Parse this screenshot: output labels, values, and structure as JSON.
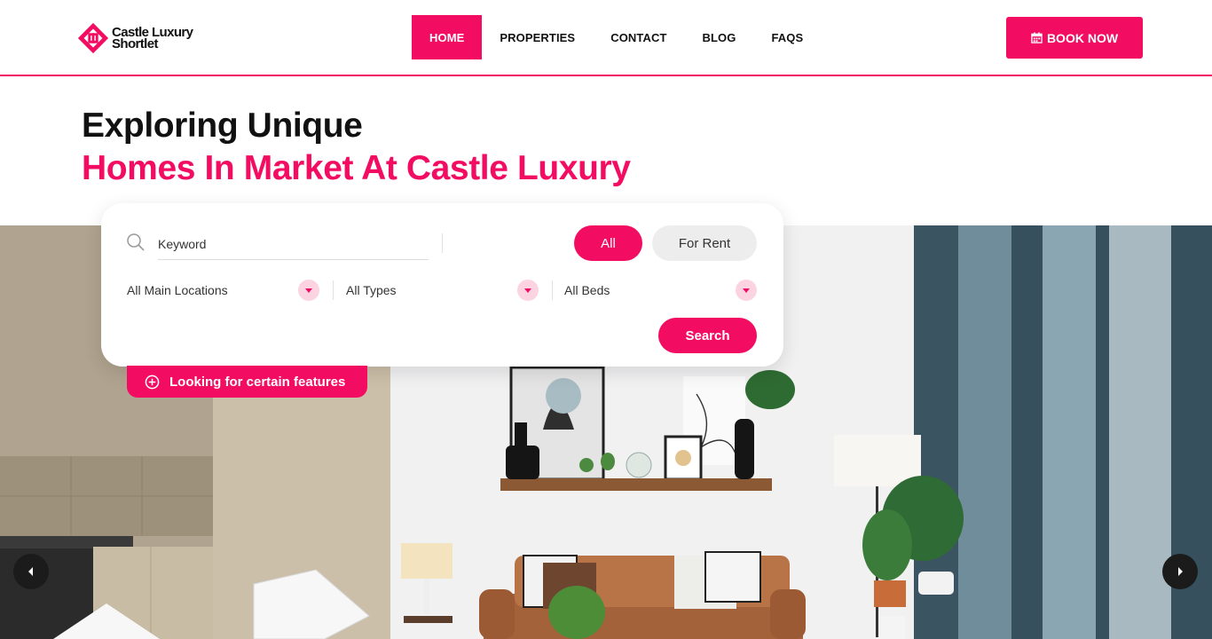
{
  "brand": {
    "line1": "Castle Luxury",
    "line2": "Shortlet",
    "accent": "#f20d63"
  },
  "nav": {
    "items": [
      {
        "label": "HOME",
        "active": true
      },
      {
        "label": "PROPERTIES"
      },
      {
        "label": "CONTACT"
      },
      {
        "label": "BLOG"
      },
      {
        "label": "FAQS"
      }
    ],
    "book_label": "BOOK NOW",
    "book_icon": "calendar-icon"
  },
  "hero": {
    "title_line1": "Exploring Unique",
    "title_line2": "Homes In Market At Castle Luxury"
  },
  "search": {
    "keyword_placeholder": "Keyword",
    "search_icon": "magnifier-icon",
    "status_tabs": [
      "All",
      "For Rent"
    ],
    "location_select": "All Main Locations",
    "type_select": "All Types",
    "beds_select": "All Beds",
    "submit_label": "Search"
  },
  "features_toggle": {
    "label": "Looking for certain features",
    "icon": "plus-circle-icon"
  },
  "slider": {
    "prev_icon": "chevron-left-icon",
    "next_icon": "chevron-right-icon"
  }
}
